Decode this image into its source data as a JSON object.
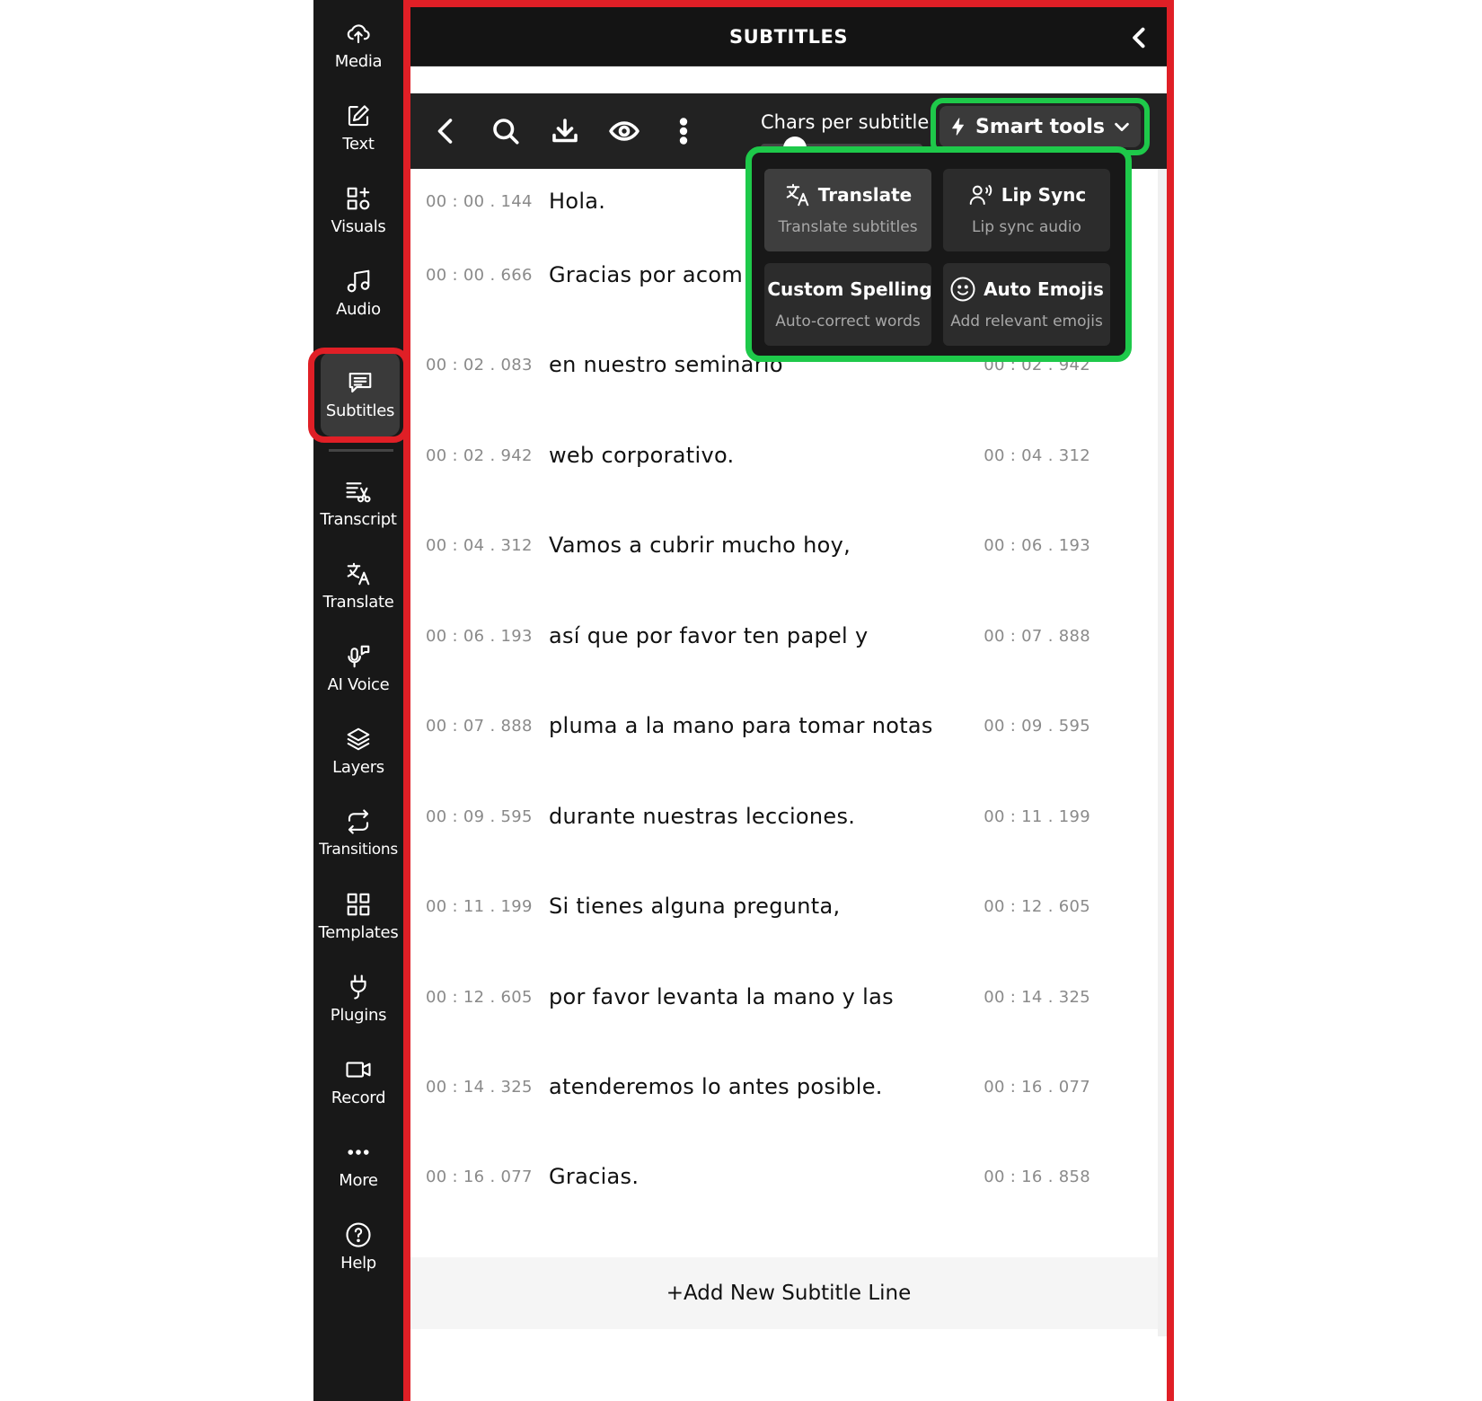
{
  "sidebar": {
    "items": [
      {
        "label": "Media",
        "icon": "upload-cloud-icon"
      },
      {
        "label": "Text",
        "icon": "edit-icon"
      },
      {
        "label": "Visuals",
        "icon": "shapes-icon"
      },
      {
        "label": "Audio",
        "icon": "music-note-icon"
      },
      {
        "label": "Subtitles",
        "icon": "chat-bubble-icon"
      },
      {
        "label": "Transcript",
        "icon": "transcript-scissors-icon"
      },
      {
        "label": "Translate",
        "icon": "translate-icon"
      },
      {
        "label": "AI Voice",
        "icon": "microphone-icon"
      },
      {
        "label": "Layers",
        "icon": "layers-icon"
      },
      {
        "label": "Transitions",
        "icon": "loop-icon"
      },
      {
        "label": "Templates",
        "icon": "grid-icon"
      },
      {
        "label": "Plugins",
        "icon": "plug-icon"
      },
      {
        "label": "Record",
        "icon": "camera-icon"
      },
      {
        "label": "More",
        "icon": "more-dots-icon"
      },
      {
        "label": "Help",
        "icon": "help-icon"
      }
    ],
    "active": "Subtitles"
  },
  "panel": {
    "title": "SUBTITLES",
    "toolbar": {
      "chars_label": "Chars per subtitle:",
      "smart_tools_label": "Smart tools"
    },
    "subtitles": [
      {
        "start": "00 : 00 . 144",
        "text": "Hola.",
        "end": ""
      },
      {
        "start": "00 : 00 . 666",
        "text": "Gracias por acom",
        "end": ""
      },
      {
        "start": "00 : 02 . 083",
        "text": "en nuestro seminario",
        "end": "00 : 02 . 942"
      },
      {
        "start": "00 : 02 . 942",
        "text": "web corporativo.",
        "end": "00 : 04 . 312"
      },
      {
        "start": "00 : 04 . 312",
        "text": "Vamos a cubrir mucho hoy,",
        "end": "00 : 06 . 193"
      },
      {
        "start": "00 : 06 . 193",
        "text": "así que por favor ten papel y",
        "end": "00 : 07 . 888"
      },
      {
        "start": "00 : 07 . 888",
        "text": "pluma a la mano para tomar notas",
        "end": "00 : 09 . 595"
      },
      {
        "start": "00 : 09 . 595",
        "text": "durante nuestras lecciones.",
        "end": "00 : 11 . 199"
      },
      {
        "start": "00 : 11 . 199",
        "text": "Si tienes alguna pregunta,",
        "end": "00 : 12 . 605"
      },
      {
        "start": "00 : 12 . 605",
        "text": "por favor levanta la mano y las",
        "end": "00 : 14 . 325"
      },
      {
        "start": "00 : 14 . 325",
        "text": "atenderemos lo antes posible.",
        "end": "00 : 16 . 077"
      },
      {
        "start": "00 : 16 . 077",
        "text": "Gracias.",
        "end": "00 : 16 . 858"
      }
    ],
    "add_line_label": "+Add New Subtitle Line"
  },
  "smart_tools": {
    "items": [
      {
        "title": "Translate",
        "subtitle": "Translate subtitles",
        "icon": "translate-icon"
      },
      {
        "title": "Lip Sync",
        "subtitle": "Lip sync audio",
        "icon": "lip-sync-icon"
      },
      {
        "title": "Custom Spelling",
        "subtitle": "Auto-correct words",
        "icon": "book-icon"
      },
      {
        "title": "Auto Emojis",
        "subtitle": "Add relevant emojis",
        "icon": "smiley-icon"
      }
    ]
  },
  "colors": {
    "highlight_red": "#e01f26",
    "highlight_green": "#1ec94a",
    "sidebar_bg": "#181818",
    "toolbar_bg": "#222222"
  }
}
